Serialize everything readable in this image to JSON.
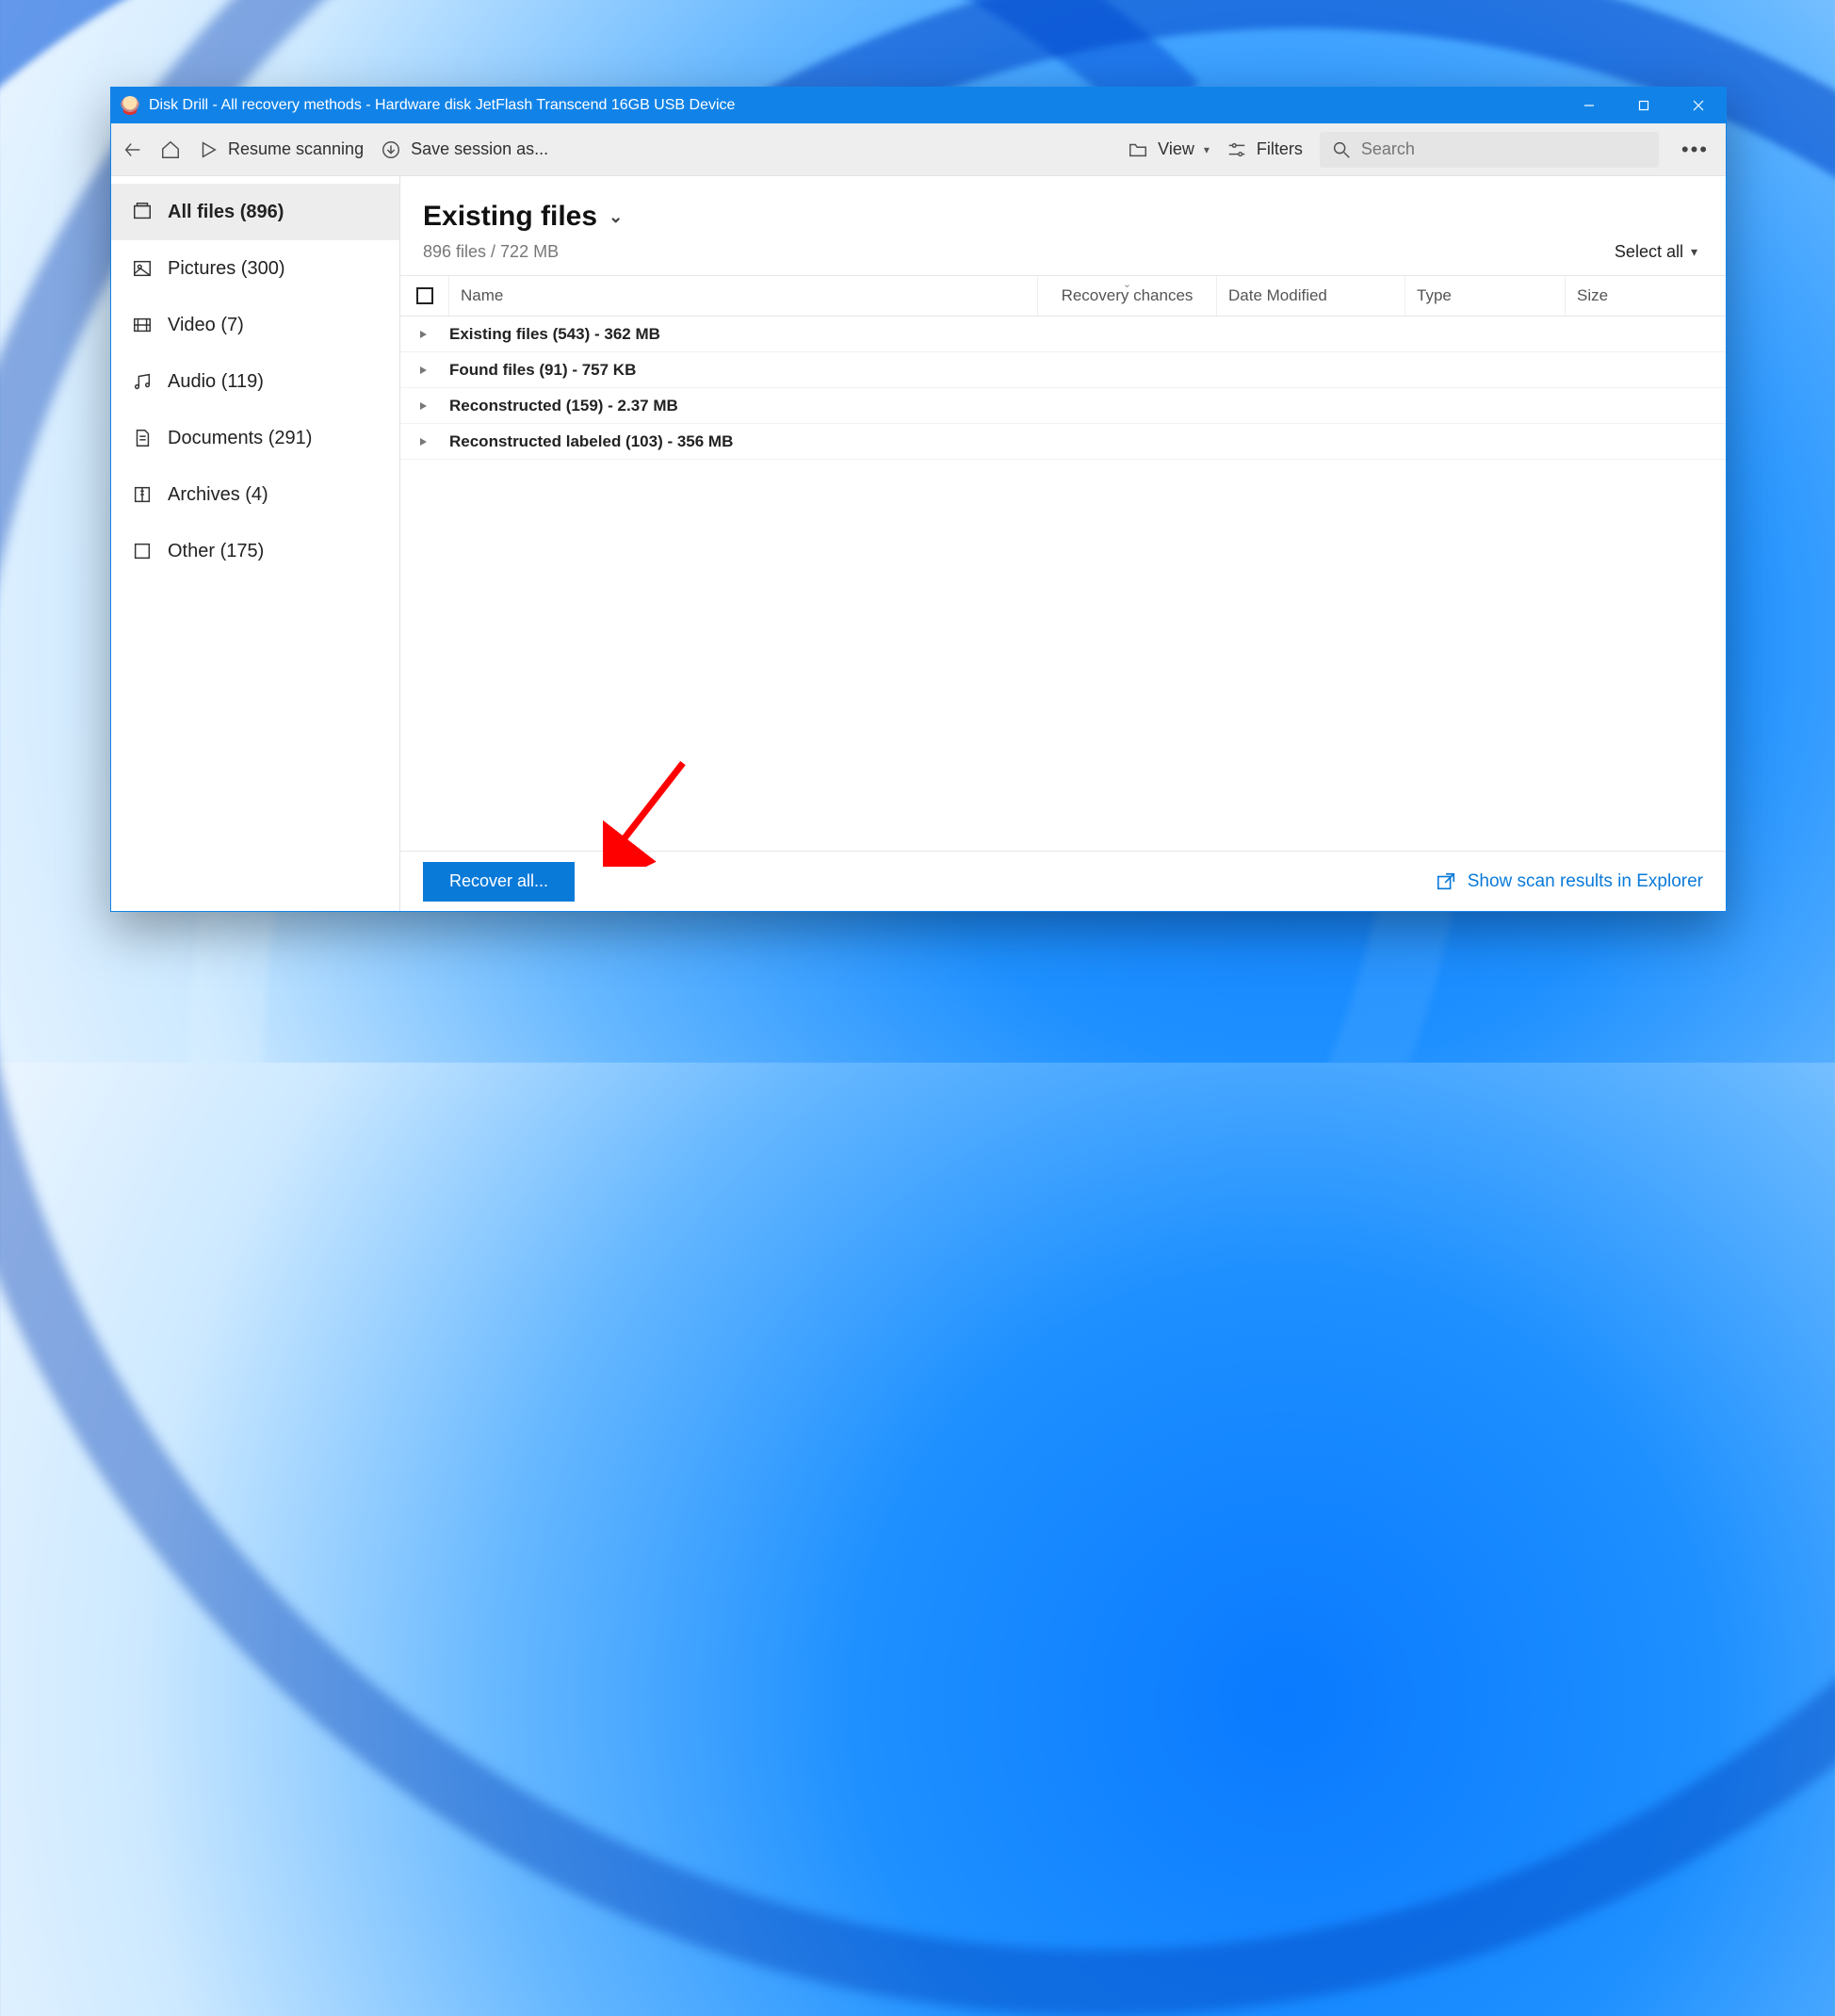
{
  "titlebar": {
    "title": "Disk Drill - All recovery methods - Hardware disk JetFlash Transcend 16GB USB Device"
  },
  "toolbar": {
    "resume_label": "Resume scanning",
    "save_session_label": "Save session as...",
    "view_label": "View",
    "filters_label": "Filters",
    "search_placeholder": "Search"
  },
  "sidebar": {
    "items": [
      {
        "label": "All files (896)"
      },
      {
        "label": "Pictures (300)"
      },
      {
        "label": "Video (7)"
      },
      {
        "label": "Audio (119)"
      },
      {
        "label": "Documents (291)"
      },
      {
        "label": "Archives (4)"
      },
      {
        "label": "Other (175)"
      }
    ]
  },
  "main": {
    "title": "Existing files",
    "subtitle": "896 files / 722 MB",
    "select_all_label": "Select all",
    "columns": {
      "name": "Name",
      "recovery": "Recovery chances",
      "date": "Date Modified",
      "type": "Type",
      "size": "Size"
    },
    "rows": [
      {
        "label": "Existing files (543) - 362 MB"
      },
      {
        "label": "Found files (91) - 757 KB"
      },
      {
        "label": "Reconstructed (159) - 2.37 MB"
      },
      {
        "label": "Reconstructed labeled (103) - 356 MB"
      }
    ]
  },
  "footer": {
    "recover_label": "Recover all...",
    "explorer_label": "Show scan results in Explorer"
  }
}
